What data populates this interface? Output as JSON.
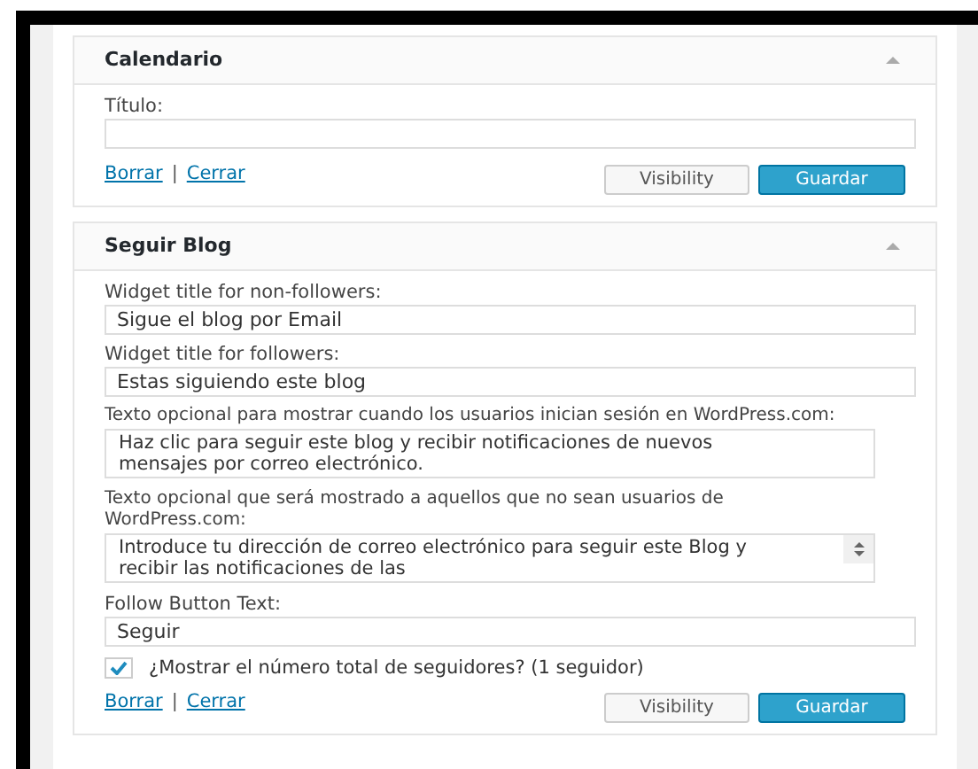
{
  "widgets": [
    {
      "title": "Calendario",
      "expanded": true,
      "fields": [
        {
          "kind": "input",
          "label": "Título:"
        }
      ],
      "links": [
        "Borrar",
        "Cerrar"
      ],
      "separator": "|",
      "buttons": [
        {
          "label": "Visibility",
          "primary": false
        },
        {
          "label": "Guardar",
          "primary": true
        }
      ]
    },
    {
      "title": "Seguir Blog",
      "expanded": true,
      "fields": [
        {
          "kind": "input",
          "label": "Widget title for non-followers:",
          "value": "Sigue el blog por Email"
        },
        {
          "kind": "input",
          "label": "Widget title for followers:",
          "value": "Estas siguiendo este blog"
        },
        {
          "kind": "textarea",
          "label": "Texto opcional para mostrar cuando los usuarios inician sesión en WordPress.com:",
          "value": "Haz clic para seguir este blog y recibir notificaciones de nuevos mensajes por correo electrónico.",
          "scrollable": false
        },
        {
          "kind": "textarea",
          "label": "Texto opcional que será mostrado a aquellos que no sean usuarios de WordPress.com:",
          "value": "Introduce tu dirección de correo electrónico para seguir este Blog y recibir las notificaciones de las",
          "scrollable": true
        },
        {
          "kind": "input",
          "label": "Follow Button Text:",
          "value": "Seguir"
        },
        {
          "kind": "checkbox",
          "label": "¿Mostrar el número total de seguidores? (1 seguidor)",
          "checked": true
        }
      ],
      "links": [
        "Borrar",
        "Cerrar"
      ],
      "separator": "|",
      "buttons": [
        {
          "label": "Visibility",
          "primary": false
        },
        {
          "label": "Guardar",
          "primary": true
        }
      ]
    }
  ]
}
